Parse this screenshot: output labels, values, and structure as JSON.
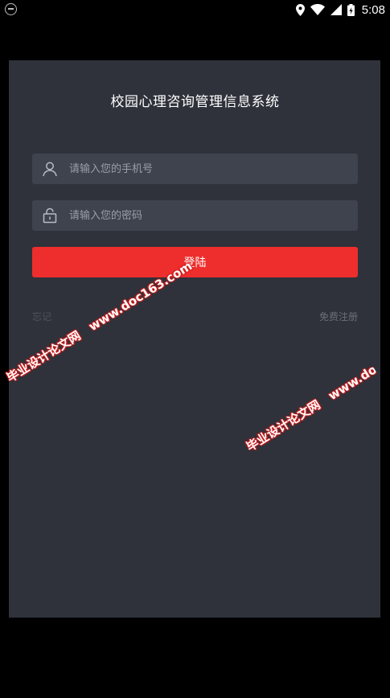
{
  "status_bar": {
    "time": "5:08",
    "icons": [
      "app-notification-icon",
      "location-icon",
      "wifi-icon",
      "signal-icon",
      "battery-icon"
    ]
  },
  "app": {
    "title": "校园心理咨询管理信息系统",
    "phone_field": {
      "icon": "user-icon",
      "placeholder": "请输入您的手机号",
      "value": ""
    },
    "password_field": {
      "icon": "lock-icon",
      "placeholder": "请输入您的密码",
      "value": ""
    },
    "login_label": "登陆",
    "forgot_label": "忘记",
    "register_label": "免费注册"
  },
  "watermark": {
    "cn": "毕业设计论文网",
    "url": "www.doc163.com"
  },
  "colors": {
    "background": "#000000",
    "card": "#2f323b",
    "field": "#3f434e",
    "accent": "#ee2e2c",
    "watermark_outline": "#d21e1e"
  }
}
